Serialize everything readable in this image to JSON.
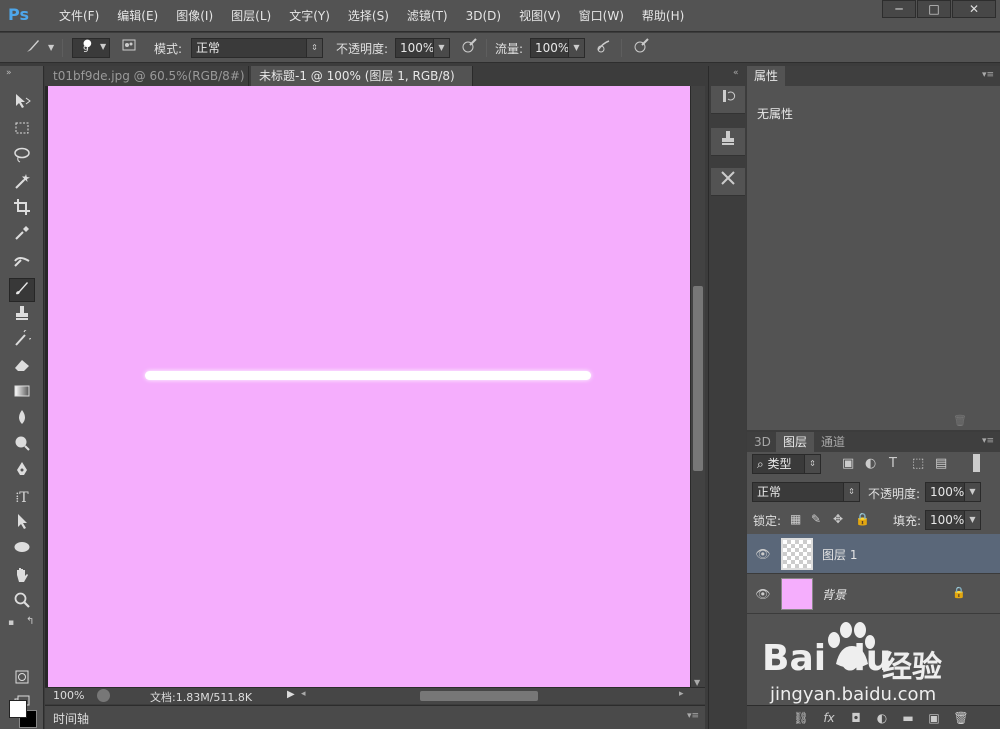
{
  "app": {
    "logo": "Ps",
    "menus": [
      "文件(F)",
      "编辑(E)",
      "图像(I)",
      "图层(L)",
      "文字(Y)",
      "选择(S)",
      "滤镜(T)",
      "3D(D)",
      "视图(V)",
      "窗口(W)",
      "帮助(H)"
    ],
    "window_controls": [
      "─",
      "□",
      "✕"
    ]
  },
  "options_bar": {
    "brush_size": "9",
    "mode_label": "模式:",
    "mode_value": "正常",
    "opacity_label": "不透明度:",
    "opacity_value": "100%",
    "flow_label": "流量:",
    "flow_value": "100%"
  },
  "tabs": [
    {
      "label": "t01bf9de.jpg @ 60.5%(RGB/8#) *",
      "close": "×",
      "active": false
    },
    {
      "label": "未标题-1 @ 100% (图层 1, RGB/8) *",
      "close": "×",
      "active": true
    }
  ],
  "canvas": {
    "background_color": "#f5aefd",
    "stroke_color": "#ffffff"
  },
  "status": {
    "zoom": "100%",
    "doc_info": "文档:1.83M/511.8K"
  },
  "timeline": {
    "label": "时间轴"
  },
  "properties_panel": {
    "tab": "属性",
    "content": "无属性"
  },
  "layers_panel": {
    "tabs": [
      "3D",
      "图层",
      "通道"
    ],
    "filter_label": "类型",
    "blend_mode": "正常",
    "opacity_label": "不透明度:",
    "opacity_value": "100%",
    "lock_label": "锁定:",
    "fill_label": "填充:",
    "fill_value": "100%",
    "layers": [
      {
        "name": "图层 1",
        "selected": true
      },
      {
        "name": "背景",
        "selected": false
      }
    ]
  },
  "watermark": {
    "brand": "Bai",
    "brand_tail": "du",
    "brand_cn": "经验",
    "url": "jingyan.baidu.com"
  },
  "colors": {
    "foreground": "#ffffff",
    "background": "#000000",
    "selected_layer": "#5a6779"
  }
}
